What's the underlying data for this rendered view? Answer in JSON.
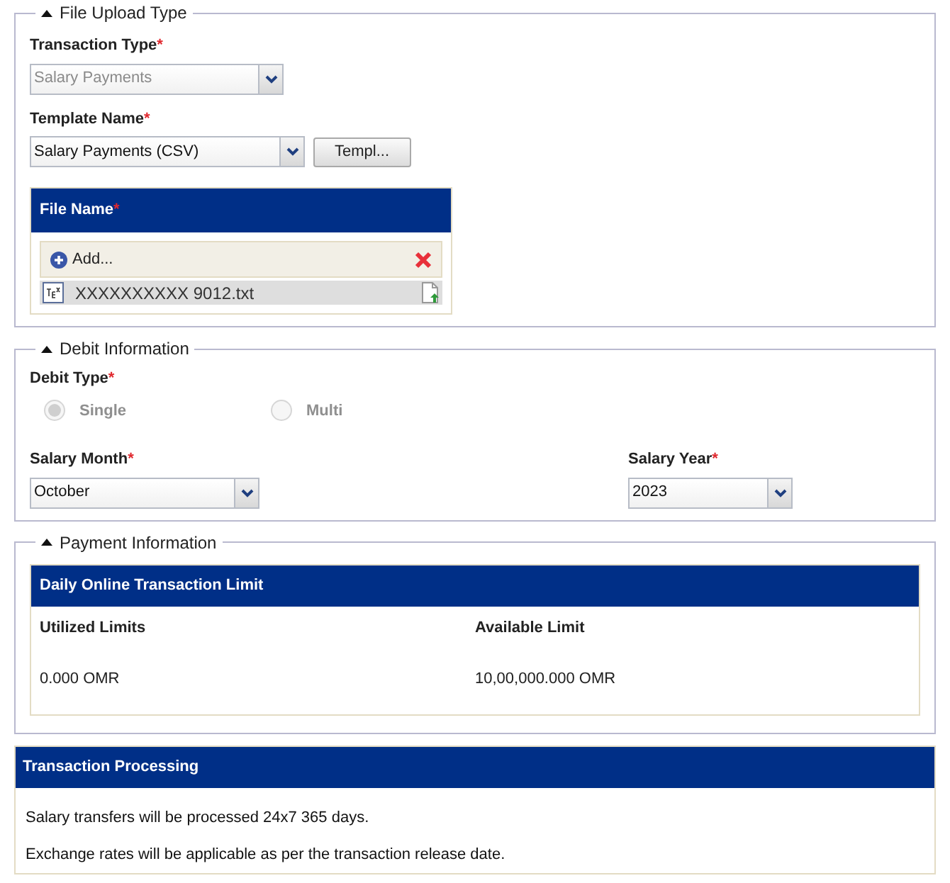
{
  "file_upload": {
    "title": "File Upload Type",
    "expanded": true,
    "transaction_type": {
      "label": "Transaction Type",
      "required": "*",
      "value": "Salary Payments",
      "disabled": true
    },
    "template_name": {
      "label": "Template Name",
      "required": "*",
      "value": "Salary Payments (CSV)",
      "disabled": false
    },
    "template_button": "Templ...",
    "file_panel": {
      "title": "File Name",
      "required": "*",
      "add_label": "Add...",
      "files": [
        {
          "name": "XXXXXXXXXX 9012.txt"
        }
      ]
    }
  },
  "debit_information": {
    "title": "Debit Information",
    "expanded": true,
    "debit_type": {
      "label": "Debit Type",
      "required": "*",
      "options": [
        {
          "label": "Single",
          "selected": true,
          "disabled": true
        },
        {
          "label": "Multi",
          "selected": false,
          "disabled": true
        }
      ]
    },
    "salary_month": {
      "label": "Salary Month",
      "required": "*",
      "value": "October",
      "disabled": false
    },
    "salary_year": {
      "label": "Salary Year",
      "required": "*",
      "value": "2023",
      "disabled": false
    }
  },
  "payment_information": {
    "title": "Payment Information",
    "expanded": true,
    "limit_panel": {
      "title": "Daily Online Transaction Limit",
      "columns": [
        {
          "label": "Utilized Limits",
          "value": "0.000 OMR"
        },
        {
          "label": "Available Limit",
          "value": "10,00,000.000 OMR"
        }
      ]
    }
  },
  "transaction_processing": {
    "title": "Transaction Processing",
    "lines": [
      "Salary transfers will be processed 24x7 365 days.",
      "Exchange rates will be applicable as per the transaction release date."
    ]
  }
}
